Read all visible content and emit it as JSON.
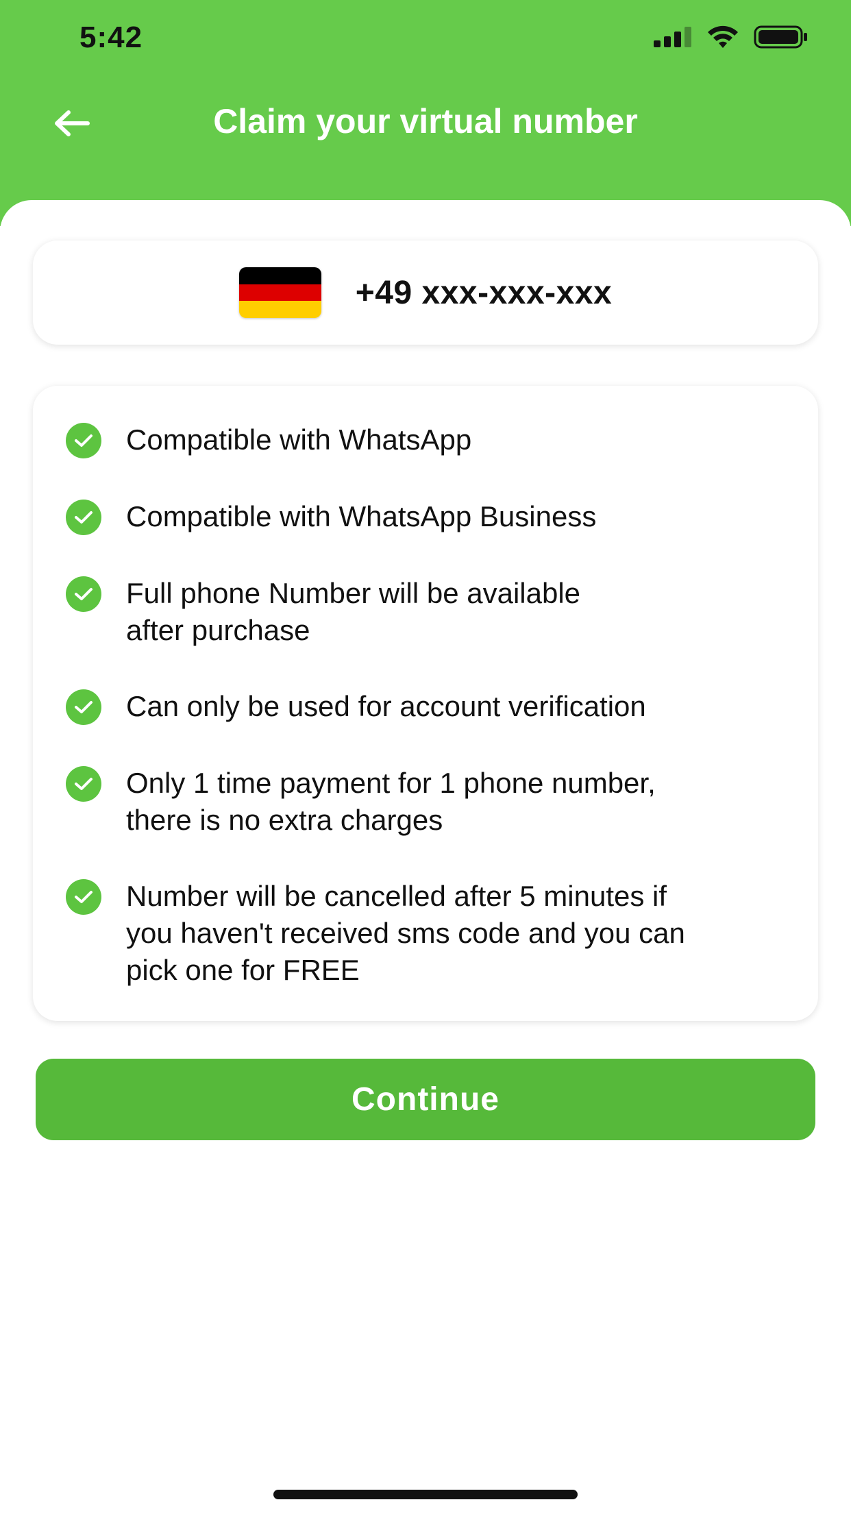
{
  "status_bar": {
    "time": "5:42"
  },
  "header": {
    "title": "Claim your virtual number"
  },
  "number_card": {
    "country_flag": "germany-flag",
    "phone_number": "+49 xxx-xxx-xxx"
  },
  "features": [
    {
      "text": "Compatible with WhatsApp"
    },
    {
      "text": "Compatible with WhatsApp Business"
    },
    {
      "text": "Full phone Number will be available\nafter purchase"
    },
    {
      "text": "Can only be used for account verification"
    },
    {
      "text": "Only 1 time payment for 1 phone number,\nthere is no extra charges"
    },
    {
      "text": "Number will be cancelled after 5 minutes if\nyou haven't received sms code and you can\npick one for FREE"
    }
  ],
  "actions": {
    "continue_label": "Continue"
  },
  "colors": {
    "header_green": "#66cb4b",
    "button_green": "#56b93a",
    "check_green": "#5dc440",
    "flag_black": "#000000",
    "flag_red": "#dd0000",
    "flag_gold": "#ffce00"
  }
}
